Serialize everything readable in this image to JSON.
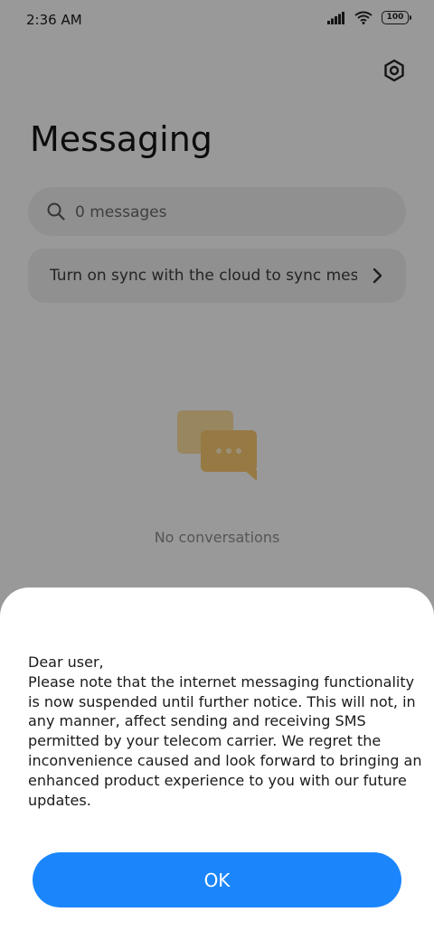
{
  "status_bar": {
    "time": "2:36 AM",
    "battery": "100"
  },
  "header": {
    "title": "Messaging"
  },
  "search": {
    "placeholder": "0 messages"
  },
  "sync_banner": {
    "text": "Turn on sync with the cloud to sync messages"
  },
  "empty_state": {
    "text": "No conversations"
  },
  "dialog": {
    "message": "Dear user,\nPlease note that the internet messaging functionality is now suspended until further notice. This will not, in any manner, affect sending and receiving SMS permitted by your telecom carrier. We regret the inconvenience caused and look forward to bringing an enhanced product experience to you with our future updates.",
    "ok_label": "OK"
  },
  "colors": {
    "accent": "#1b86fb",
    "empty_icon": "#f2c46d"
  },
  "icons": [
    "signal-icon",
    "wifi-icon",
    "battery-icon",
    "settings-icon",
    "search-icon",
    "chevron-right-icon",
    "chat-bubbles-icon"
  ]
}
